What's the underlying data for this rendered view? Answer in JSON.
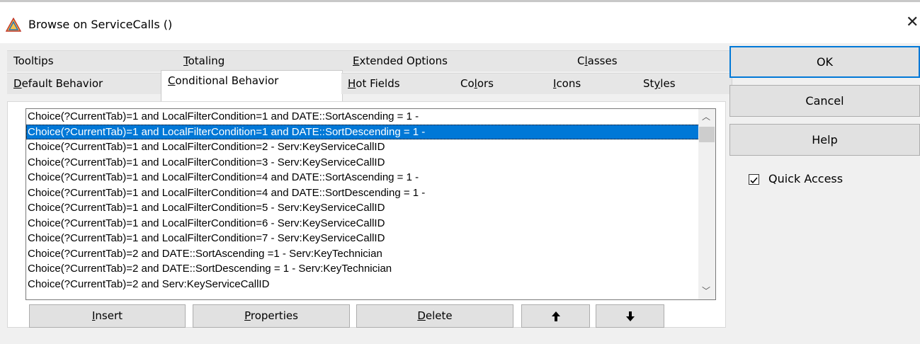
{
  "window": {
    "title": "Browse on ServiceCalls ()"
  },
  "tabs_row1": [
    {
      "label_pre": "",
      "label_u": "",
      "label_post": "Tooltips"
    },
    {
      "label_pre": "",
      "label_u": "T",
      "label_post": "otaling"
    },
    {
      "label_pre": "",
      "label_u": "E",
      "label_post": "xtended Options"
    },
    {
      "label_pre": "C",
      "label_u": "l",
      "label_post": "asses"
    }
  ],
  "tabs_row2": [
    {
      "label_pre": "",
      "label_u": "D",
      "label_post": "efault Behavior"
    },
    {
      "label_pre": "",
      "label_u": "C",
      "label_post": "onditional Behavior"
    },
    {
      "label_pre": "",
      "label_u": "H",
      "label_post": "ot Fields"
    },
    {
      "label_pre": "Co",
      "label_u": "l",
      "label_post": "ors"
    },
    {
      "label_pre": "",
      "label_u": "I",
      "label_post": "cons"
    },
    {
      "label_pre": "St",
      "label_u": "y",
      "label_post": "les"
    }
  ],
  "list": {
    "items": [
      "Choice(?CurrentTab)=1 and LocalFilterCondition=1 and DATE::SortAscending = 1 -",
      "Choice(?CurrentTab)=1 and LocalFilterCondition=1 and DATE::SortDescending = 1 -",
      "Choice(?CurrentTab)=1 and LocalFilterCondition=2 - Serv:KeyServiceCallID",
      "Choice(?CurrentTab)=1 and LocalFilterCondition=3 - Serv:KeyServiceCallID",
      "Choice(?CurrentTab)=1 and LocalFilterCondition=4  and DATE::SortAscending = 1 -",
      "Choice(?CurrentTab)=1 and LocalFilterCondition=4  and DATE::SortDescending = 1 -",
      "Choice(?CurrentTab)=1 and LocalFilterCondition=5 - Serv:KeyServiceCallID",
      "Choice(?CurrentTab)=1 and LocalFilterCondition=6 - Serv:KeyServiceCallID",
      "Choice(?CurrentTab)=1 and LocalFilterCondition=7 - Serv:KeyServiceCallID",
      "Choice(?CurrentTab)=2 and DATE::SortAscending =1 - Serv:KeyTechnician",
      "Choice(?CurrentTab)=2 and DATE::SortDescending = 1 - Serv:KeyTechnician",
      "Choice(?CurrentTab)=2 and Serv:KeyServiceCallID"
    ],
    "selected_index": 1
  },
  "buttons": {
    "insert": {
      "u": "I",
      "rest": "nsert"
    },
    "properties": {
      "u": "P",
      "rest": "roperties"
    },
    "delete": {
      "u": "D",
      "rest": "elete"
    },
    "up_arrow": "🡅",
    "down_arrow": "🡇"
  },
  "side": {
    "ok": "OK",
    "cancel": "Cancel",
    "help": "Help",
    "quick_access": "Quick Access",
    "quick_access_checked": true
  },
  "icons": {
    "app": "triangle-app-icon",
    "close": "close-icon",
    "scroll_up": "chevron-up-icon",
    "scroll_down": "chevron-down-icon"
  },
  "colors": {
    "selection": "#0078d7",
    "default_button_border": "#0078d7"
  }
}
